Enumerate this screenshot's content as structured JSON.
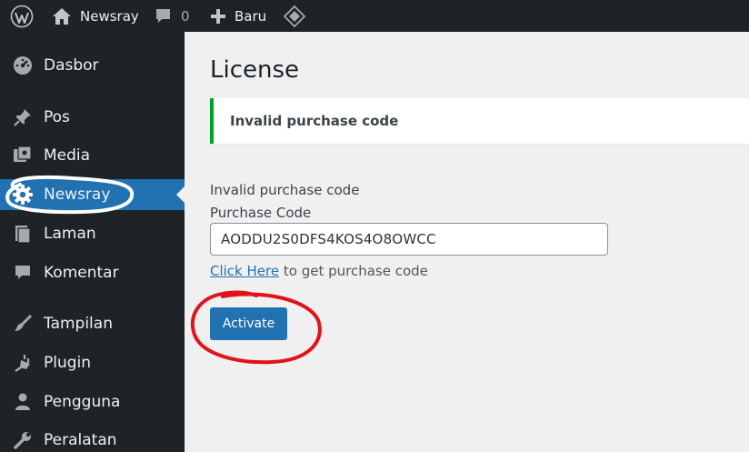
{
  "adminbar": {
    "site_name": "Newsray",
    "comments_count": "0",
    "new_label": "Baru"
  },
  "sidebar": {
    "items": [
      {
        "label": "Dasbor",
        "icon": "dashboard-icon"
      },
      {
        "label": "Pos",
        "icon": "pin-icon"
      },
      {
        "label": "Media",
        "icon": "media-icon"
      },
      {
        "label": "Newsray",
        "icon": "gear-icon",
        "active": true
      },
      {
        "label": "Laman",
        "icon": "page-icon"
      },
      {
        "label": "Komentar",
        "icon": "comment-icon"
      },
      {
        "label": "Tampilan",
        "icon": "brush-icon"
      },
      {
        "label": "Plugin",
        "icon": "plugin-icon"
      },
      {
        "label": "Pengguna",
        "icon": "user-icon"
      },
      {
        "label": "Peralatan",
        "icon": "wrench-icon"
      }
    ]
  },
  "main": {
    "title": "License",
    "notice": "Invalid purchase code",
    "error_text": "Invalid purchase code",
    "field_label": "Purchase Code",
    "purchase_code_value": "AODDU2S0DFS4KOS4O8OWCC",
    "help_link": "Click Here",
    "help_text": "to get purchase code",
    "activate_label": "Activate"
  },
  "colors": {
    "adminbar_bg": "#1d2327",
    "accent": "#2271b1",
    "notice_border": "#00a32a",
    "annotation_white": "#ffffff",
    "annotation_red": "#e0131b"
  }
}
